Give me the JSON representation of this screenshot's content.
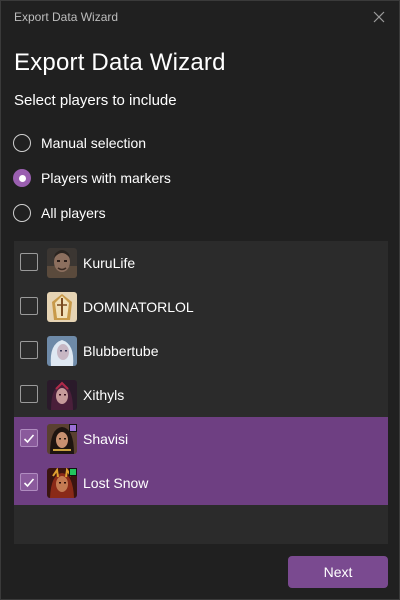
{
  "window": {
    "title": "Export Data Wizard"
  },
  "heading": "Export Data Wizard",
  "subheading": "Select players to include",
  "options": [
    {
      "label": "Manual selection",
      "selected": false
    },
    {
      "label": "Players with markers",
      "selected": true
    },
    {
      "label": "All players",
      "selected": false
    }
  ],
  "players": [
    {
      "name": "KuruLife",
      "checked": false,
      "avatar_icon": "hero-portrait-dark-armored",
      "marker_color": null
    },
    {
      "name": "DOMINATORLOL",
      "checked": false,
      "avatar_icon": "hero-portrait-golden-helm",
      "marker_color": null
    },
    {
      "name": "Blubbertube",
      "checked": false,
      "avatar_icon": "hero-portrait-white-hair",
      "marker_color": null
    },
    {
      "name": "Xithyls",
      "checked": false,
      "avatar_icon": "hero-portrait-dark-sorceress",
      "marker_color": null
    },
    {
      "name": "Shavisi",
      "checked": true,
      "avatar_icon": "hero-portrait-dark-hair",
      "marker_color": "#9b6fd6"
    },
    {
      "name": "Lost Snow",
      "checked": true,
      "avatar_icon": "hero-portrait-red-horned",
      "marker_color": "#22c55e"
    }
  ],
  "next_label": "Next",
  "colors": {
    "accent": "#9a5fb0",
    "selected_row": "#6e3f82",
    "button": "#7a4a90",
    "background": "#202020",
    "list_background": "#2b2b2b"
  }
}
